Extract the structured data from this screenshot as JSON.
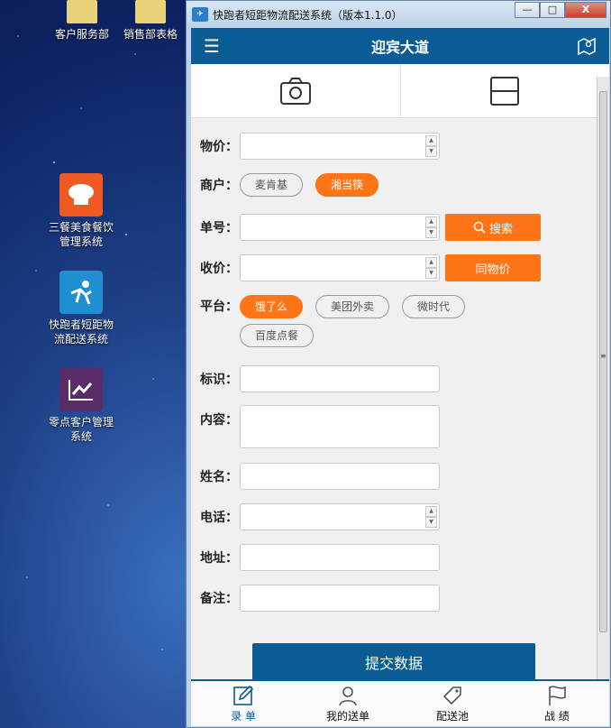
{
  "desktop": {
    "icons": [
      {
        "label": "客户服务部"
      },
      {
        "label": "销售部表格"
      },
      {
        "label": "三餐美食餐饮管理系统"
      },
      {
        "label": "快跑者短距物流配送系统"
      },
      {
        "label": "零点客户管理系统"
      }
    ]
  },
  "window": {
    "title": "快跑者短距物流配送系统（版本1.1.0）",
    "minimize": "—",
    "maximize": "□",
    "close": "X"
  },
  "app": {
    "header_title": "迎宾大道",
    "form": {
      "price_label": "物价：",
      "merchant_label": "商户：",
      "merchants": [
        {
          "label": "麦肯基",
          "selected": false
        },
        {
          "label": "湘当筷",
          "selected": true
        }
      ],
      "order_label": "单号：",
      "search_button": "搜索",
      "receive_label": "收价：",
      "same_price_button": "同物价",
      "platform_label": "平台：",
      "platforms": [
        {
          "label": "饿了么",
          "selected": true
        },
        {
          "label": "美团外卖",
          "selected": false
        },
        {
          "label": "微时代",
          "selected": false
        },
        {
          "label": "百度点餐",
          "selected": false
        }
      ],
      "mark_label": "标识：",
      "content_label": "内容：",
      "name_label": "姓名：",
      "phone_label": "电话：",
      "address_label": "地址：",
      "remark_label": "备注：",
      "submit_button": "提交数据"
    },
    "tabs": [
      {
        "label": "录 单",
        "icon": "edit-icon"
      },
      {
        "label": "我的送单",
        "icon": "user-icon"
      },
      {
        "label": "配送池",
        "icon": "tag-icon"
      },
      {
        "label": "战 绩",
        "icon": "flag-icon"
      }
    ],
    "accent_color": "#0a5c94",
    "orange_color": "#ff7416"
  }
}
